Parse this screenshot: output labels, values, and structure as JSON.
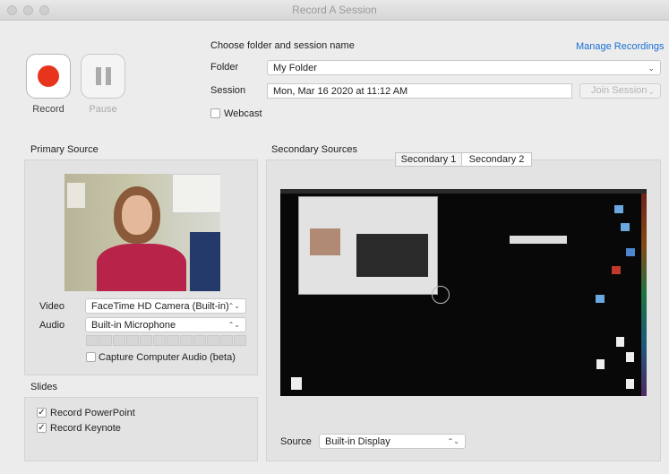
{
  "window": {
    "title": "Record A Session"
  },
  "recording": {
    "record_label": "Record",
    "pause_label": "Pause",
    "record_color": "#e8341c"
  },
  "session": {
    "heading": "Choose folder and session name",
    "manage_link": "Manage Recordings",
    "folder_label": "Folder",
    "folder_value": "My Folder",
    "session_label": "Session",
    "session_value": "Mon, Mar 16 2020 at 11:12 AM",
    "join_label": "Join Session",
    "webcast_label": "Webcast"
  },
  "primary": {
    "heading": "Primary Source",
    "video_label": "Video",
    "video_value": "FaceTime HD Camera (Built-in)",
    "audio_label": "Audio",
    "audio_value": "Built-in Microphone",
    "capture_audio_label": "Capture Computer Audio (beta)"
  },
  "slides": {
    "heading": "Slides",
    "powerpoint_label": "Record PowerPoint",
    "keynote_label": "Record Keynote"
  },
  "secondary": {
    "heading": "Secondary Sources",
    "tabs": [
      "Secondary 1",
      "Secondary 2"
    ],
    "source_label": "Source",
    "source_value": "Built-in Display"
  },
  "icons": {
    "checkmark": "✓",
    "select_arrows": "⌃⌄",
    "dropdown": "⌄"
  }
}
